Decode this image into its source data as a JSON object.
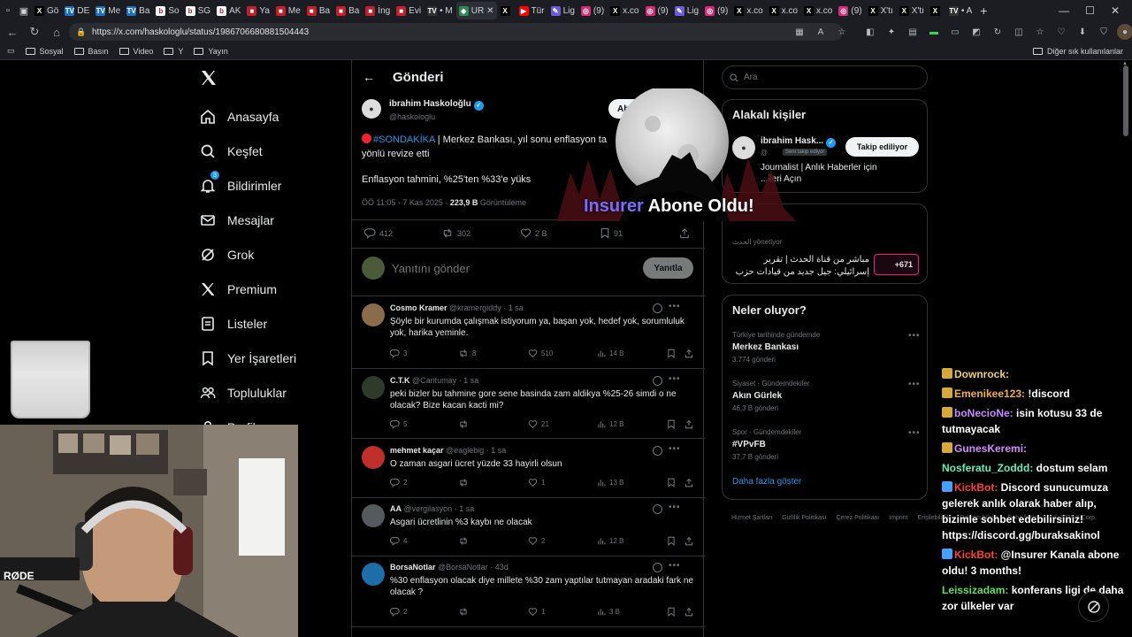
{
  "browser": {
    "tabs": [
      {
        "title": "Gö",
        "icon": "x-icon",
        "color": "#000000"
      },
      {
        "title": "DE",
        "icon": "tv-icon",
        "color": "#1e6fbf"
      },
      {
        "title": "Me",
        "icon": "tv-icon",
        "color": "#1e6fbf"
      },
      {
        "title": "Ba",
        "icon": "tv-icon",
        "color": "#1e6fbf"
      },
      {
        "title": "So",
        "icon": "b-icon",
        "color": "#ffffff"
      },
      {
        "title": "SG",
        "icon": "b-icon",
        "color": "#ffffff"
      },
      {
        "title": "AK",
        "icon": "b-icon",
        "color": "#ffffff"
      },
      {
        "title": "Ya",
        "icon": "news-icon",
        "color": "#c0202a"
      },
      {
        "title": "Me",
        "icon": "news-icon",
        "color": "#c0202a"
      },
      {
        "title": "Ba",
        "icon": "news-icon",
        "color": "#c0202a"
      },
      {
        "title": "Ba",
        "icon": "news-icon",
        "color": "#c0202a"
      },
      {
        "title": "İng",
        "icon": "news-icon",
        "color": "#c0202a"
      },
      {
        "title": "Evi",
        "icon": "news-icon",
        "color": "#c0202a"
      },
      {
        "title": "• M",
        "icon": "tv-icon",
        "color": "#333333"
      },
      {
        "title": "UR",
        "icon": "shield-icon",
        "color": "#2d8a4e",
        "active": true
      },
      {
        "title": "",
        "icon": "x-icon",
        "color": "#000000"
      },
      {
        "title": "Tür",
        "icon": "youtube-icon",
        "color": "#ff0000"
      },
      {
        "title": "Lig",
        "icon": "feather-icon",
        "color": "#6b5bd6"
      },
      {
        "title": "(9)",
        "icon": "instagram-icon",
        "color": "#d62976"
      },
      {
        "title": "x.co",
        "icon": "x-icon",
        "color": "#000000"
      },
      {
        "title": "(9)",
        "icon": "instagram-icon",
        "color": "#d62976"
      },
      {
        "title": "Lig",
        "icon": "feather-icon",
        "color": "#6b5bd6"
      },
      {
        "title": "(9)",
        "icon": "instagram-icon",
        "color": "#d62976"
      },
      {
        "title": "x.co",
        "icon": "x-icon",
        "color": "#000000"
      },
      {
        "title": "x.co",
        "icon": "x-icon",
        "color": "#000000"
      },
      {
        "title": "x.co",
        "icon": "x-icon",
        "color": "#000000"
      },
      {
        "title": "(9)",
        "icon": "instagram-icon",
        "color": "#d62976"
      },
      {
        "title": "X'tı",
        "icon": "x-icon",
        "color": "#000000"
      },
      {
        "title": "X'tı",
        "icon": "x-icon",
        "color": "#000000"
      },
      {
        "title": "",
        "icon": "x-icon",
        "color": "#000000"
      },
      {
        "title": "• A",
        "icon": "tv-icon",
        "color": "#333333"
      }
    ],
    "url": "https://x.com/haskologlu/status/1986706680881504443",
    "bookmarks": [
      "Sosyal",
      "Basın",
      "Video",
      "Y",
      "Yayın"
    ],
    "bookmarks_right": "Diğer sık kullanılanlar"
  },
  "nav": {
    "items": [
      {
        "label": "Anasayfa",
        "icon": "home-icon"
      },
      {
        "label": "Keşfet",
        "icon": "search-icon"
      },
      {
        "label": "Bildirimler",
        "icon": "bell-icon"
      },
      {
        "label": "Mesajlar",
        "icon": "mail-icon"
      },
      {
        "label": "Grok",
        "icon": "grok-icon"
      },
      {
        "label": "Premium",
        "icon": "x-icon"
      },
      {
        "label": "Listeler",
        "icon": "list-icon"
      },
      {
        "label": "Yer İşaretleri",
        "icon": "bookmark-icon"
      },
      {
        "label": "Topluluklar",
        "icon": "people-icon"
      },
      {
        "label": "Profil",
        "icon": "user-icon"
      }
    ],
    "notification_count": "3"
  },
  "main": {
    "title": "Gönderi",
    "tweet": {
      "name": "ibrahim Haskoloğlu",
      "handle": "@haskologlu",
      "follow_label": "Abo",
      "hashtag": "#SONDAKİKA",
      "body_line1": " | Merkez Bankası, yıl sonu enflasyon ta",
      "body_line2": "yönlü revize etti",
      "body2": "Enflasyon tahmini, %25'ten %33'e yüks",
      "time": "ÖÖ 11:05 · 7 Kas 2025 · ",
      "views": "223,9 B",
      "views_label": " Görüntüleme",
      "replies": "412",
      "reposts": "302",
      "likes": "2 B",
      "bookmarks": "91"
    },
    "reply_placeholder": "Yanıtını gönder",
    "reply_button": "Yanıtla",
    "replies": [
      {
        "name": "Cosmo Kramer",
        "handle": "@kramergiddy",
        "time": "· 1 sa",
        "text": "Şöyle bir kurumda çalışmak istiyorum ya, başan yok, hedef yok, sorumluluk yok, harika yeminle.",
        "r": "3",
        "rt": "8",
        "l": "510",
        "v": "14 B",
        "avatar_color": "#8a6b4a"
      },
      {
        "name": "C.T.K",
        "handle": "@Cantumay",
        "time": "· 1 sa",
        "text": "peki bizler bu tahmine gore sene basinda zam aldikya %25-26 simdi o ne olacak? Bize kacan kacti mi?",
        "r": "5",
        "rt": "",
        "l": "21",
        "v": "12 B",
        "avatar_color": "#2f3a2a"
      },
      {
        "name": "mehmet kaçar",
        "handle": "@eaglebig",
        "time": "· 1 sa",
        "text": "O zaman asgari ücret yüzde 33 hayirli olsun",
        "r": "2",
        "rt": "",
        "l": "1",
        "v": "13 B",
        "avatar_color": "#c0302a"
      },
      {
        "name": "AA",
        "handle": "@vergilasyon",
        "time": "· 1 sa",
        "text": "Asgari ücretlinin %3 kaybı ne olacak",
        "r": "4",
        "rt": "",
        "l": "2",
        "v": "12 B",
        "avatar_color": "#555a5e"
      },
      {
        "name": "BorsaNotlar",
        "handle": "@BorsaNotlar",
        "time": "· 43d",
        "text": "%30 enflasyon olacak diye millete %30 zam yaptılar tutmayan aradaki fark ne olacak ?",
        "r": "2",
        "rt": "",
        "l": "1",
        "v": "3 B",
        "avatar_color": "#1d6ea8"
      }
    ]
  },
  "sidebar": {
    "search_placeholder": "Ara",
    "related_title": "Alakalı kişiler",
    "related_name": "ibrahim Hask...",
    "related_handle": "@",
    "related_badge": "Seni takip ediyor",
    "related_bio": "Journalist | Anlık Haberler için ...ileri Açın",
    "related_button": "Takip ediliyor",
    "space_host": "الحدث  yönetiyor",
    "space_title": "مباشر من قناة الحدث | تقرير إسرائيلي: جيل جديد من قيادات حزب",
    "space_count": "+671",
    "trends_title": "Neler oluyor?",
    "trends": [
      {
        "context": "Türkiye tarihinde gündemde",
        "name": "Merkez Bankası",
        "count": "3.774 gönderi"
      },
      {
        "context": "Siyaset · Gündemdekiler",
        "name": "Akın Gürlek",
        "count": "46,3 B gönderi"
      },
      {
        "context": "Spor · Gündemdekiler",
        "name": "#VPvFB",
        "count": "37,7 B gönderi"
      }
    ],
    "show_more": "Daha fazla göster",
    "footer": [
      "Hizmet Şartları",
      "Gizlilik Politikası",
      "Çerez Politikası",
      "Imprint",
      "Erişilebilirlik",
      "Reklam bilgisi",
      "Daha fazla ...",
      "© 2025 X Corp."
    ]
  },
  "overlay": {
    "alert_user": "Insurer",
    "alert_text": " Abone Oldu!",
    "accent": "#7c6bff",
    "chat": [
      {
        "user": "Downrock:",
        "msg": "",
        "color": "#f0d060",
        "icon": "badge-icon"
      },
      {
        "user": "Emenikee123:",
        "msg": " !discord",
        "color": "#f0b040",
        "icon": "badge-icon"
      },
      {
        "user": "boNecioNe:",
        "msg": " isin kotusu 33 de tutmayacak",
        "color": "#c58bff",
        "icon": "badge-icon"
      },
      {
        "user": "GunesKeremi:",
        "msg": "",
        "color": "#d58bff",
        "icon": "badge-icon"
      },
      {
        "user": "Nosferatu_Zoddd:",
        "msg": " dostum selam",
        "color": "#5ef0c0",
        "icon": ""
      },
      {
        "user": "KickBot:",
        "msg": " Discord sunucumuza gelerek anlık olarak haber alıp, bizimle sohbet edebilirsiniz! https://discord.gg/buraksakinol",
        "color": "#ff4040",
        "icon": "bot-icon"
      },
      {
        "user": "KickBot:",
        "msg": " @Insurer Kanala abone oldu! 3 months!",
        "color": "#ff4040",
        "icon": "bot-icon"
      },
      {
        "user": "Leissizadam:",
        "msg": " konferans ligi de daha zor ülkeler var",
        "color": "#60e060",
        "icon": ""
      }
    ]
  }
}
